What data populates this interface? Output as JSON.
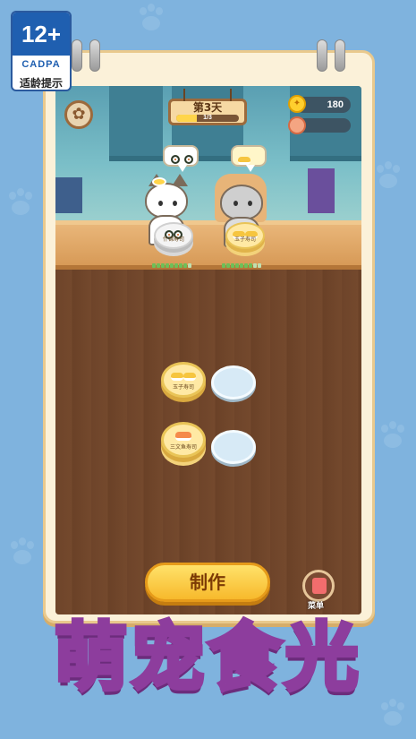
{
  "age_rating": {
    "age": "12+",
    "org": "CADPA",
    "tip": "适龄提示"
  },
  "hud": {
    "day_title": "第3天",
    "progress_text": "1/3",
    "progress_fraction": 0.33,
    "coins": "180"
  },
  "customers": [
    {
      "plate_label": "什锦寿司",
      "order": "maki"
    },
    {
      "plate_label": "玉子寿司",
      "order": "nigiri"
    }
  ],
  "kitchen": {
    "plates": [
      {
        "label": "玉子寿司"
      },
      {
        "label": "三文鱼寿司"
      }
    ]
  },
  "buttons": {
    "make": "制作",
    "menu": "菜单"
  },
  "title": "萌宠食光",
  "colors": {
    "accent": "#f7b92c",
    "title_fill": "#ffb8c4",
    "title_stroke": "#8d3d9d",
    "background": "#7fb3de"
  }
}
